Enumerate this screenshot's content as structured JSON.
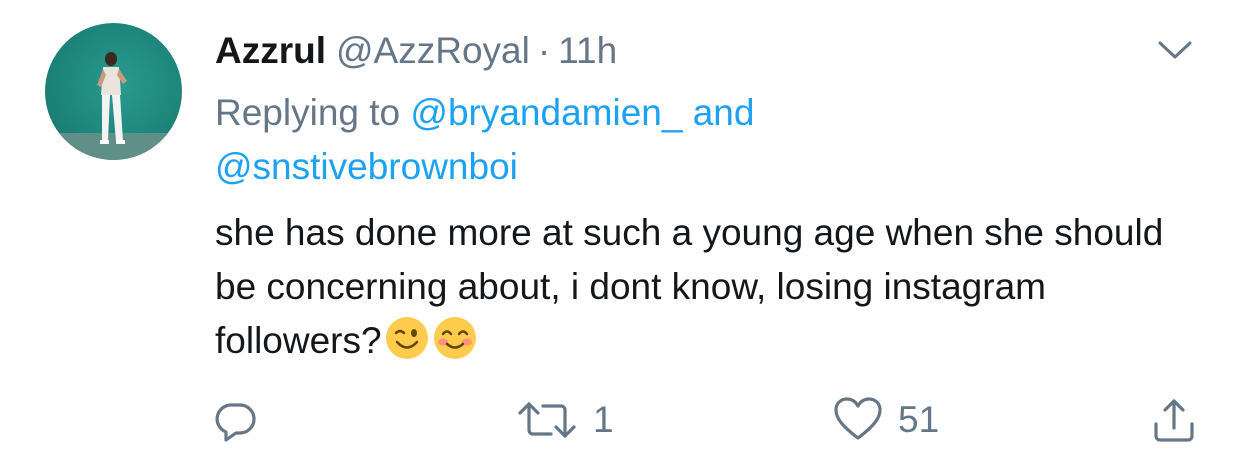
{
  "tweet": {
    "display_name": "Azzrul",
    "handle": "@AzzRoyal",
    "separator": "·",
    "time": "11h",
    "replying_prefix": "Replying to",
    "mention_1": "@bryandamien_",
    "mention_joiner": "and",
    "mention_2": "@snstivebrownboi",
    "text": "she has done more at such a young age when she should be concerning about, i dont know, losing instagram followers?",
    "emojis": [
      "winking-face-emoji",
      "smiling-face-with-smiling-eyes-emoji"
    ]
  },
  "actions": {
    "reply_icon": "reply-icon",
    "retweet_icon": "retweet-icon",
    "retweet_count": "1",
    "like_icon": "heart-icon",
    "like_count": "51",
    "share_icon": "share-icon"
  },
  "colors": {
    "text": "#14171a",
    "secondary": "#657786",
    "link": "#1da1f2",
    "avatar_bg": "#1f8a7f"
  }
}
